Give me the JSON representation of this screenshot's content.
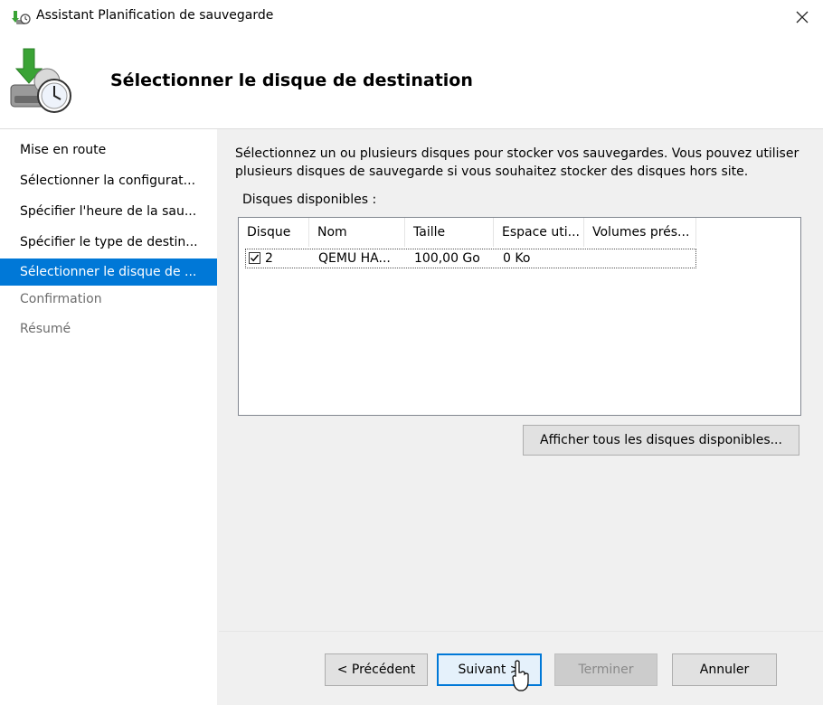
{
  "window": {
    "title": "Assistant Planification de sauvegarde",
    "heading": "Sélectionner le disque de destination"
  },
  "nav": {
    "items": [
      {
        "label": "Mise en route",
        "state": "normal"
      },
      {
        "label": "Sélectionner la configurat...",
        "state": "normal"
      },
      {
        "label": "Spécifier l'heure de la sau...",
        "state": "normal"
      },
      {
        "label": "Spécifier le type de destin...",
        "state": "normal"
      },
      {
        "label": "Sélectionner le disque de ...",
        "state": "active"
      },
      {
        "label": "Confirmation",
        "state": "disabled"
      },
      {
        "label": "Résumé",
        "state": "disabled"
      }
    ]
  },
  "main": {
    "description": "Sélectionnez un ou plusieurs disques pour stocker vos sauvegardes. Vous pouvez utiliser plusieurs disques de sauvegarde si vous souhaitez stocker des disques hors site.",
    "available_label": "Disques disponibles :",
    "table": {
      "columns": [
        "Disque",
        "Nom",
        "Taille",
        "Espace uti...",
        "Volumes prés..."
      ],
      "rows": [
        {
          "checked": true,
          "disque": "2",
          "nom": "QEMU HA...",
          "taille": "100,00 Go",
          "espace": "0 Ko",
          "volumes": ""
        }
      ]
    },
    "show_all_button": "Afficher tous les disques disponibles..."
  },
  "footer": {
    "previous": "< Précédent",
    "next": "Suivant >",
    "finish": "Terminer",
    "cancel": "Annuler"
  },
  "colors": {
    "accent": "#0078d7",
    "window_bg": "#f0f0f0",
    "panel_bg": "#ffffff",
    "disabled_text": "#6d6d6d"
  }
}
